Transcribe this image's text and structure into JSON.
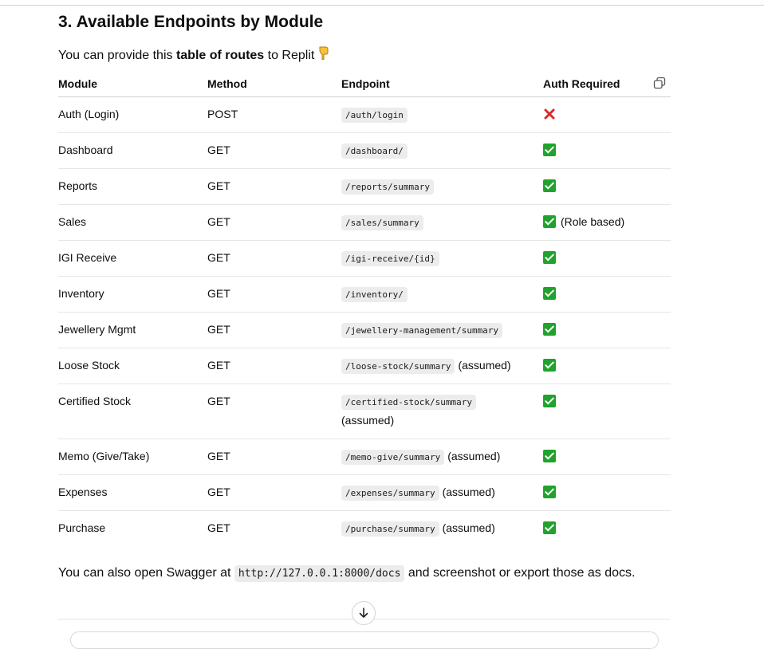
{
  "heading": {
    "number": "3.",
    "text": "Available Endpoints by Module"
  },
  "intro": {
    "before": "You can provide this ",
    "bold": "table of routes",
    "after": " to Replit"
  },
  "pointer_icon": "backhand-index-pointing-down-emoji",
  "table": {
    "headers": [
      "Module",
      "Method",
      "Endpoint",
      "Auth Required"
    ],
    "rows": [
      {
        "module": "Auth (Login)",
        "method": "POST",
        "endpoint": "/auth/login",
        "note": "",
        "auth": "no",
        "auth_note": ""
      },
      {
        "module": "Dashboard",
        "method": "GET",
        "endpoint": "/dashboard/",
        "note": "",
        "auth": "yes",
        "auth_note": ""
      },
      {
        "module": "Reports",
        "method": "GET",
        "endpoint": "/reports/summary",
        "note": "",
        "auth": "yes",
        "auth_note": ""
      },
      {
        "module": "Sales",
        "method": "GET",
        "endpoint": "/sales/summary",
        "note": "",
        "auth": "yes",
        "auth_note": "(Role based)"
      },
      {
        "module": "IGI Receive",
        "method": "GET",
        "endpoint": "/igi-receive/{id}",
        "note": "",
        "auth": "yes",
        "auth_note": ""
      },
      {
        "module": "Inventory",
        "method": "GET",
        "endpoint": "/inventory/",
        "note": "",
        "auth": "yes",
        "auth_note": ""
      },
      {
        "module": "Jewellery Mgmt",
        "method": "GET",
        "endpoint": "/jewellery-management/summary",
        "note": "",
        "auth": "yes",
        "auth_note": ""
      },
      {
        "module": "Loose Stock",
        "method": "GET",
        "endpoint": "/loose-stock/summary",
        "note": "(assumed)",
        "auth": "yes",
        "auth_note": ""
      },
      {
        "module": "Certified Stock",
        "method": "GET",
        "endpoint": "/certified-stock/summary",
        "note": "(assumed)",
        "auth": "yes",
        "auth_note": ""
      },
      {
        "module": "Memo (Give/Take)",
        "method": "GET",
        "endpoint": "/memo-give/summary",
        "note": "(assumed)",
        "auth": "yes",
        "auth_note": ""
      },
      {
        "module": "Expenses",
        "method": "GET",
        "endpoint": "/expenses/summary",
        "note": "(assumed)",
        "auth": "yes",
        "auth_note": ""
      },
      {
        "module": "Purchase",
        "method": "GET",
        "endpoint": "/purchase/summary",
        "note": "(assumed)",
        "auth": "yes",
        "auth_note": ""
      }
    ]
  },
  "outro": {
    "before": "You can also open Swagger at ",
    "code": "http://127.0.0.1:8000/docs",
    "after": " and screenshot or export those as docs."
  },
  "icons": {
    "copy": "copy-table-icon",
    "scroll": "arrow-down-icon",
    "yes": "green-check-box-icon",
    "no": "red-cross-icon"
  },
  "colors": {
    "check_green": "#20a32d",
    "cross_red": "#d92b2b",
    "code_bg": "#ececec"
  }
}
